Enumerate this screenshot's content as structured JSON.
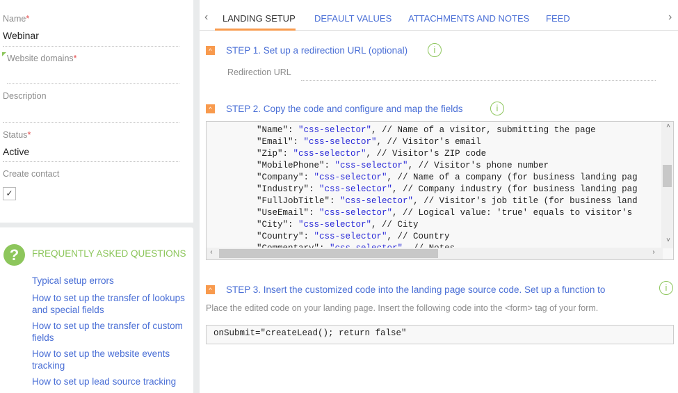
{
  "form": {
    "name": {
      "label": "Name",
      "value": "Webinar"
    },
    "website_domains": {
      "label": "Website domains",
      "value": ""
    },
    "description": {
      "label": "Description",
      "value": ""
    },
    "status": {
      "label": "Status",
      "value": "Active"
    },
    "create_contact": {
      "label": "Create contact",
      "checked": true,
      "check": "✓"
    },
    "required_mark": "*"
  },
  "faq": {
    "title": "FREQUENTLY ASKED QUESTIONS",
    "icon": "?",
    "links": [
      "Typical setup errors",
      "How to set up the transfer of lookups and special fields",
      "How to set up the transfer of custom fields",
      "How to set up the website events tracking",
      "How to set up lead source tracking"
    ]
  },
  "tabs": [
    "LANDING SETUP",
    "DEFAULT VALUES",
    "ATTACHMENTS AND NOTES",
    "FEED"
  ],
  "active_tab": "LANDING SETUP",
  "steps": {
    "step1": {
      "title": "STEP 1. Set up a redirection URL (optional)",
      "field_label": "Redirection URL",
      "field_value": ""
    },
    "step2": {
      "title": "STEP 2. Copy the code and configure and map the fields"
    },
    "step3": {
      "title": "STEP 3. Insert the customized code into the landing page source code. Set up a function to",
      "description": "Place the edited code on your landing page. Insert the following code into the <form> tag of your form.",
      "code": "onSubmit=\"createLead(); return false\""
    }
  },
  "code_lines": [
    [
      "\"Name\": ",
      "\"css-selector\"",
      ", // Name of a visitor, submitting the page"
    ],
    [
      "\"Email\": ",
      "\"css-selector\"",
      ", // Visitor's email"
    ],
    [
      "\"Zip\": ",
      "\"css-selector\"",
      ", // Visitor's ZIP code"
    ],
    [
      "\"MobilePhone\": ",
      "\"css-selector\"",
      ", // Visitor's phone number"
    ],
    [
      "\"Company\": ",
      "\"css-selector\"",
      ", // Name of a company (for business landing pag"
    ],
    [
      "\"Industry\": ",
      "\"css-selector\"",
      ", // Company industry (for business landing pag"
    ],
    [
      "\"FullJobTitle\": ",
      "\"css-selector\"",
      ", // Visitor's job title (for business land"
    ],
    [
      "\"UseEmail\": ",
      "\"css-selector\"",
      ", // Logical value: 'true' equals to visitor's"
    ],
    [
      "\"City\": ",
      "\"css-selector\"",
      ", // City"
    ],
    [
      "\"Country\": ",
      "\"css-selector\"",
      ", // Country"
    ],
    [
      "\"Commentary\": ",
      "\"css-selector\"",
      ", // Notes"
    ]
  ],
  "colors": {
    "accent": "#f89a4d",
    "link": "#4a6fd6",
    "green": "#8dc65c"
  }
}
